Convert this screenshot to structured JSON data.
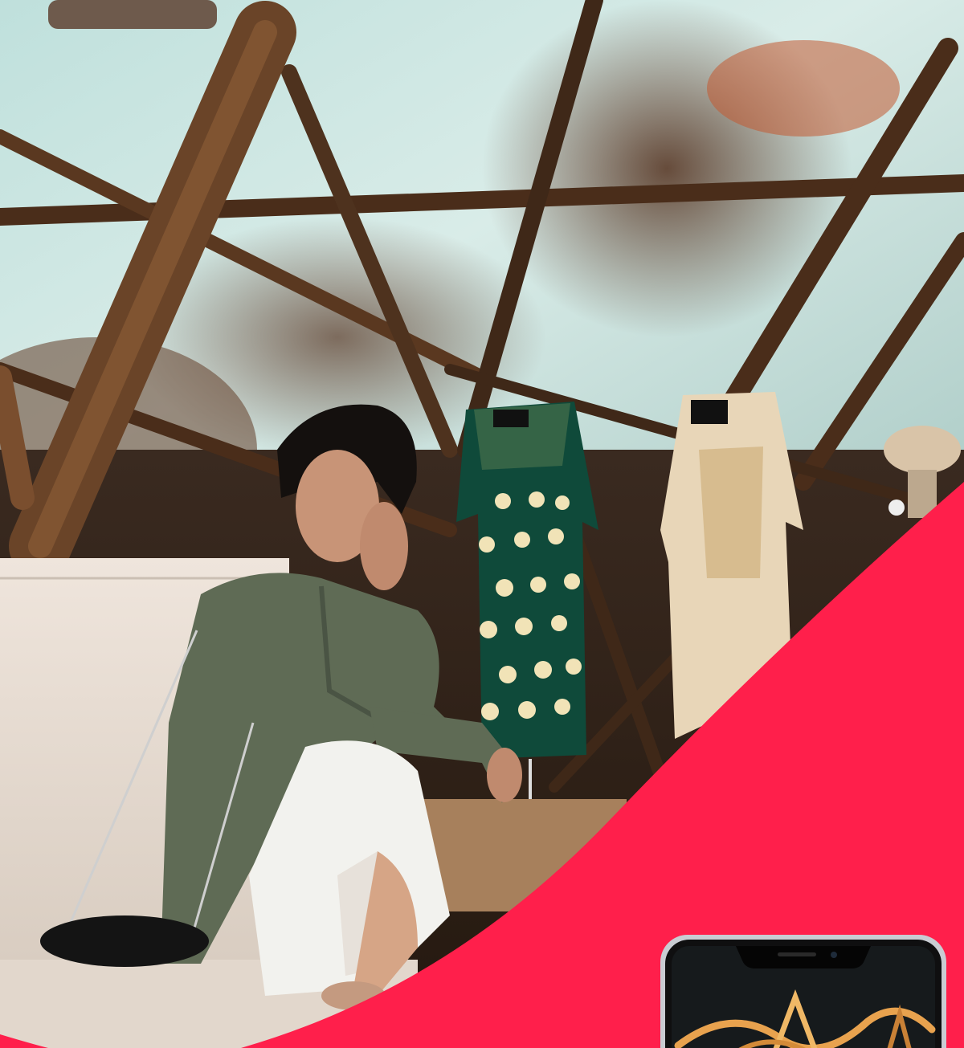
{
  "scene": {
    "caption": ""
  },
  "colors": {
    "accent": "#ff1f4b",
    "wall_light": "#cfe6e2",
    "wood": "#5a3a22",
    "sofa": "#e6dcd3",
    "jacket": "#5f6b55",
    "pants": "#f2f2ee",
    "dress_green": "#0f4a3a",
    "dress_cream": "#e8d6b8",
    "phone_frame": "#b9bcc2"
  },
  "icons": {
    "phone": "smartphone-icon",
    "camera": "camera-dot-icon"
  }
}
